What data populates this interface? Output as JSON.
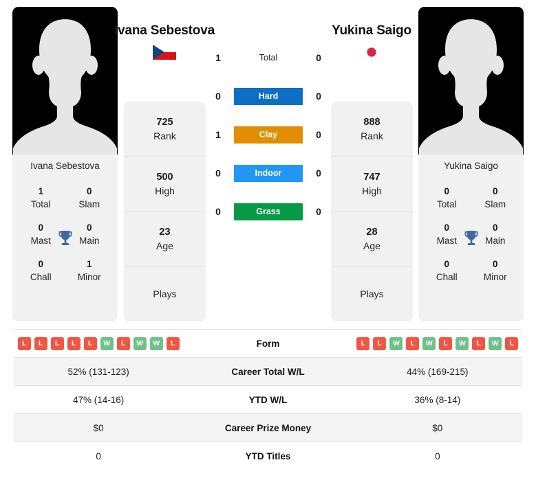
{
  "colors": {
    "win": "#6fc08a",
    "loss": "#ef5744",
    "trophy": "#41699f",
    "hard": "#0d6fc4",
    "clay": "#e08e00",
    "indoor": "#2196f3",
    "grass": "#069a46"
  },
  "players": {
    "left": {
      "name": "Ivana Sebestova",
      "flag": "czech-republic-flag",
      "photo_alt": "player-photo-placeholder",
      "titles": [
        {
          "num": "1",
          "label": "Total"
        },
        {
          "num": "0",
          "label": "Slam"
        },
        {
          "num": "0",
          "label": "Mast"
        },
        {
          "num": "0",
          "label": "Main"
        },
        {
          "num": "0",
          "label": "Chall"
        },
        {
          "num": "1",
          "label": "Minor"
        }
      ],
      "stats": [
        {
          "num": "725",
          "label": "Rank"
        },
        {
          "num": "500",
          "label": "High"
        },
        {
          "num": "23",
          "label": "Age"
        },
        {
          "num": "",
          "label": "Plays"
        }
      ],
      "form": [
        "L",
        "L",
        "L",
        "L",
        "L",
        "W",
        "L",
        "W",
        "W",
        "L"
      ]
    },
    "right": {
      "name": "Yukina Saigo",
      "flag": "japan-flag",
      "photo_alt": "player-photo-placeholder",
      "titles": [
        {
          "num": "0",
          "label": "Total"
        },
        {
          "num": "0",
          "label": "Slam"
        },
        {
          "num": "0",
          "label": "Mast"
        },
        {
          "num": "0",
          "label": "Main"
        },
        {
          "num": "0",
          "label": "Chall"
        },
        {
          "num": "0",
          "label": "Minor"
        }
      ],
      "stats": [
        {
          "num": "888",
          "label": "Rank"
        },
        {
          "num": "747",
          "label": "High"
        },
        {
          "num": "28",
          "label": "Age"
        },
        {
          "num": "",
          "label": "Plays"
        }
      ],
      "form": [
        "L",
        "L",
        "W",
        "L",
        "W",
        "L",
        "W",
        "L",
        "W",
        "L"
      ]
    }
  },
  "head_to_head": [
    {
      "label": "Total",
      "left": "1",
      "right": "0",
      "type": "text"
    },
    {
      "label": "Hard",
      "left": "0",
      "right": "0",
      "type": "badge",
      "color": "#0d6fc4"
    },
    {
      "label": "Clay",
      "left": "1",
      "right": "0",
      "type": "badge",
      "color": "#e08e00"
    },
    {
      "label": "Indoor",
      "left": "0",
      "right": "0",
      "type": "badge",
      "color": "#2196f3"
    },
    {
      "label": "Grass",
      "left": "0",
      "right": "0",
      "type": "badge",
      "color": "#069a46"
    }
  ],
  "table": [
    {
      "label": "Form",
      "left": "",
      "right": "",
      "type": "form",
      "shaded": false
    },
    {
      "label": "Career Total W/L",
      "left": "52% (131-123)",
      "right": "44% (169-215)",
      "type": "text",
      "shaded": true
    },
    {
      "label": "YTD W/L",
      "left": "47% (14-16)",
      "right": "36% (8-14)",
      "type": "text",
      "shaded": false
    },
    {
      "label": "Career Prize Money",
      "left": "$0",
      "right": "$0",
      "type": "text",
      "shaded": true
    },
    {
      "label": "YTD Titles",
      "left": "0",
      "right": "0",
      "type": "text",
      "shaded": false
    }
  ]
}
